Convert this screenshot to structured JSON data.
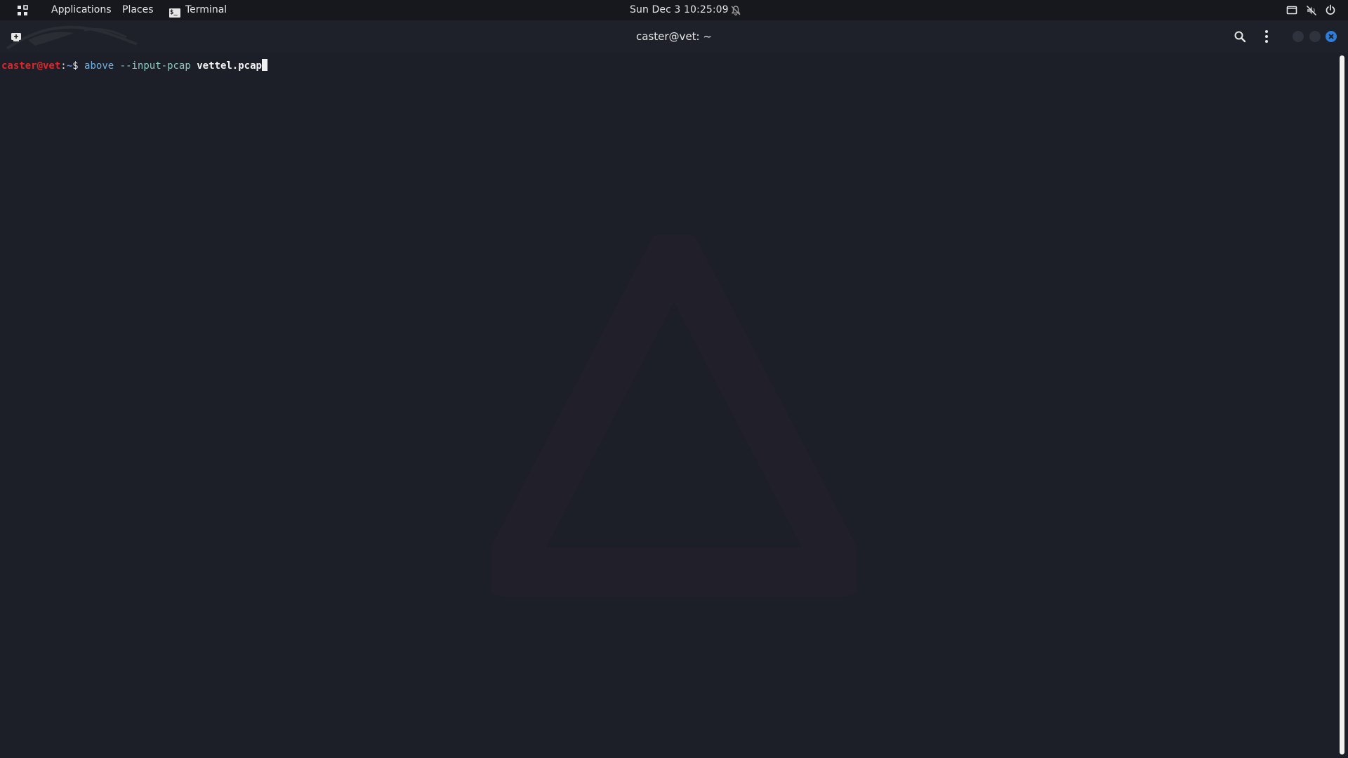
{
  "top_panel": {
    "applications_label": "Applications",
    "places_label": "Places",
    "terminal_label": "Terminal",
    "terminal_glyph": "$_",
    "clock": "Sun Dec 3  10:25:09"
  },
  "window": {
    "title": "caster@vet: ~",
    "accent_color": "#2c7ed8"
  },
  "terminal": {
    "prompt_user_host": "caster@vet",
    "prompt_sep": ":",
    "prompt_path": "~",
    "prompt_symbol": "$",
    "command": "above",
    "option": "--input-pcap",
    "argument": "vettel.pcap"
  },
  "icons": {
    "apps": "apps-grid-icon",
    "notifications": "bell-off-icon",
    "display": "display-icon",
    "volume": "volume-muted-icon",
    "power": "power-icon",
    "new_tab": "new-tab-icon",
    "search": "search-icon",
    "menu": "kebab-menu-icon",
    "close": "close-icon"
  }
}
